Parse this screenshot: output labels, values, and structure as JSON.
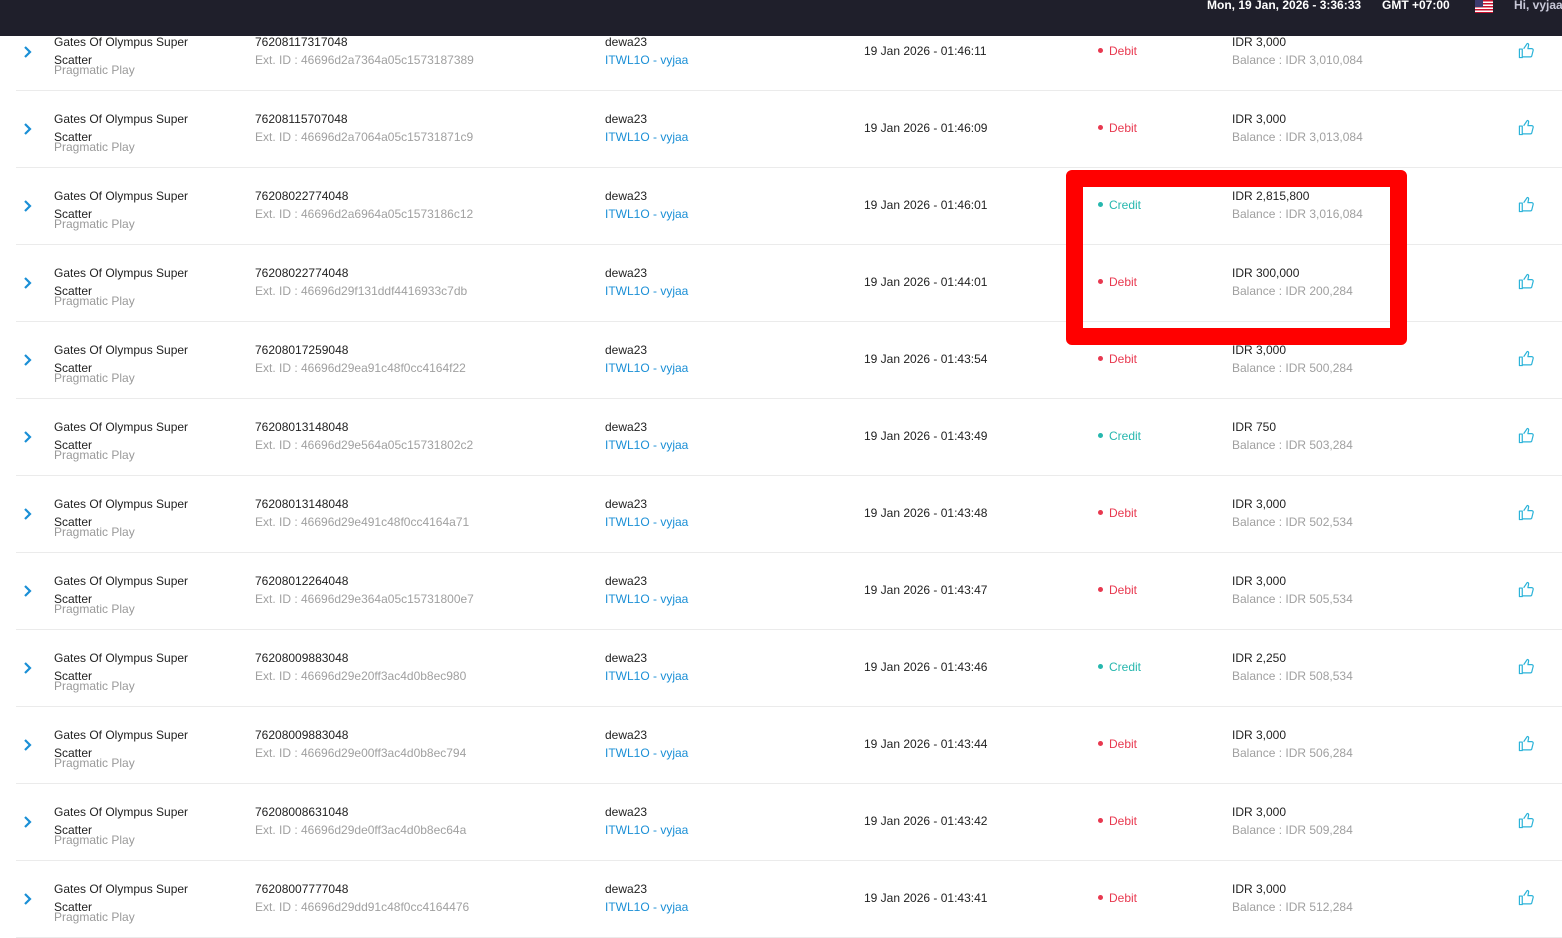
{
  "header": {
    "datetime": "Mon, 19 Jan, 2026 - 3:36:33",
    "timezone": "GMT +07:00",
    "greeting": "Hi, vyjaa"
  },
  "colors": {
    "debit": "#e8384f",
    "credit": "#26b7ae",
    "link": "#1a8fd6",
    "highlight": "#ff0000"
  },
  "icons": {
    "row_expand": "chevron-right-icon",
    "row_action": "thumbs-up-icon",
    "language": "us-flag-icon"
  },
  "rows": [
    {
      "game": "Gates Of Olympus Super Scatter",
      "provider": "Pragmatic Play",
      "txid": "76208117317048",
      "extid": "Ext. ID : 46696d2a7364a05c1573187389",
      "user": "dewa23",
      "agent": "ITWL1O - vyjaa",
      "date": "19 Jan 2026 - 01:46:11",
      "type": "Debit",
      "amount": "IDR 3,000",
      "balance": "Balance : IDR 3,010,084"
    },
    {
      "game": "Gates Of Olympus Super Scatter",
      "provider": "Pragmatic Play",
      "txid": "76208115707048",
      "extid": "Ext. ID : 46696d2a7064a05c15731871c9",
      "user": "dewa23",
      "agent": "ITWL1O - vyjaa",
      "date": "19 Jan 2026 - 01:46:09",
      "type": "Debit",
      "amount": "IDR 3,000",
      "balance": "Balance : IDR 3,013,084"
    },
    {
      "game": "Gates Of Olympus Super Scatter",
      "provider": "Pragmatic Play",
      "txid": "76208022774048",
      "extid": "Ext. ID : 46696d2a6964a05c1573186c12",
      "user": "dewa23",
      "agent": "ITWL1O - vyjaa",
      "date": "19 Jan 2026 - 01:46:01",
      "type": "Credit",
      "amount": "IDR 2,815,800",
      "balance": "Balance : IDR 3,016,084"
    },
    {
      "game": "Gates Of Olympus Super Scatter",
      "provider": "Pragmatic Play",
      "txid": "76208022774048",
      "extid": "Ext. ID : 46696d29f131ddf4416933c7db",
      "user": "dewa23",
      "agent": "ITWL1O - vyjaa",
      "date": "19 Jan 2026 - 01:44:01",
      "type": "Debit",
      "amount": "IDR 300,000",
      "balance": "Balance : IDR 200,284"
    },
    {
      "game": "Gates Of Olympus Super Scatter",
      "provider": "Pragmatic Play",
      "txid": "76208017259048",
      "extid": "Ext. ID : 46696d29ea91c48f0cc4164f22",
      "user": "dewa23",
      "agent": "ITWL1O - vyjaa",
      "date": "19 Jan 2026 - 01:43:54",
      "type": "Debit",
      "amount": "IDR 3,000",
      "balance": "Balance : IDR 500,284"
    },
    {
      "game": "Gates Of Olympus Super Scatter",
      "provider": "Pragmatic Play",
      "txid": "76208013148048",
      "extid": "Ext. ID : 46696d29e564a05c15731802c2",
      "user": "dewa23",
      "agent": "ITWL1O - vyjaa",
      "date": "19 Jan 2026 - 01:43:49",
      "type": "Credit",
      "amount": "IDR 750",
      "balance": "Balance : IDR 503,284"
    },
    {
      "game": "Gates Of Olympus Super Scatter",
      "provider": "Pragmatic Play",
      "txid": "76208013148048",
      "extid": "Ext. ID : 46696d29e491c48f0cc4164a71",
      "user": "dewa23",
      "agent": "ITWL1O - vyjaa",
      "date": "19 Jan 2026 - 01:43:48",
      "type": "Debit",
      "amount": "IDR 3,000",
      "balance": "Balance : IDR 502,534"
    },
    {
      "game": "Gates Of Olympus Super Scatter",
      "provider": "Pragmatic Play",
      "txid": "76208012264048",
      "extid": "Ext. ID : 46696d29e364a05c15731800e7",
      "user": "dewa23",
      "agent": "ITWL1O - vyjaa",
      "date": "19 Jan 2026 - 01:43:47",
      "type": "Debit",
      "amount": "IDR 3,000",
      "balance": "Balance : IDR 505,534"
    },
    {
      "game": "Gates Of Olympus Super Scatter",
      "provider": "Pragmatic Play",
      "txid": "76208009883048",
      "extid": "Ext. ID : 46696d29e20ff3ac4d0b8ec980",
      "user": "dewa23",
      "agent": "ITWL1O - vyjaa",
      "date": "19 Jan 2026 - 01:43:46",
      "type": "Credit",
      "amount": "IDR 2,250",
      "balance": "Balance : IDR 508,534"
    },
    {
      "game": "Gates Of Olympus Super Scatter",
      "provider": "Pragmatic Play",
      "txid": "76208009883048",
      "extid": "Ext. ID : 46696d29e00ff3ac4d0b8ec794",
      "user": "dewa23",
      "agent": "ITWL1O - vyjaa",
      "date": "19 Jan 2026 - 01:43:44",
      "type": "Debit",
      "amount": "IDR 3,000",
      "balance": "Balance : IDR 506,284"
    },
    {
      "game": "Gates Of Olympus Super Scatter",
      "provider": "Pragmatic Play",
      "txid": "76208008631048",
      "extid": "Ext. ID : 46696d29de0ff3ac4d0b8ec64a",
      "user": "dewa23",
      "agent": "ITWL1O - vyjaa",
      "date": "19 Jan 2026 - 01:43:42",
      "type": "Debit",
      "amount": "IDR 3,000",
      "balance": "Balance : IDR 509,284"
    },
    {
      "game": "Gates Of Olympus Super Scatter",
      "provider": "Pragmatic Play",
      "txid": "76208007777048",
      "extid": "Ext. ID : 46696d29dd91c48f0cc4164476",
      "user": "dewa23",
      "agent": "ITWL1O - vyjaa",
      "date": "19 Jan 2026 - 01:43:41",
      "type": "Debit",
      "amount": "IDR 3,000",
      "balance": "Balance : IDR 512,284"
    }
  ]
}
